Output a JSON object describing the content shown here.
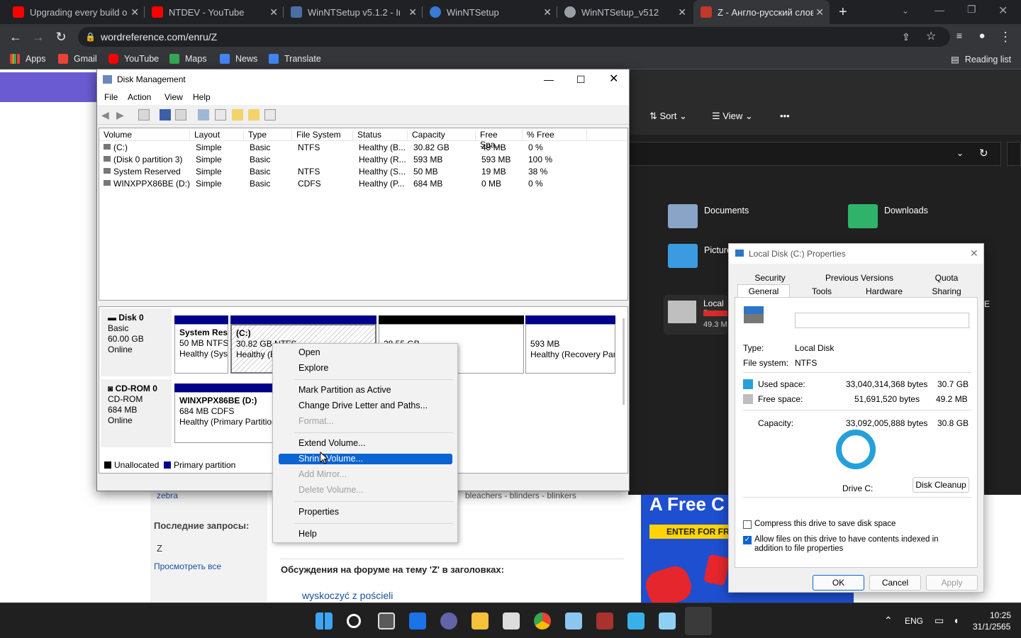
{
  "browser": {
    "tabs": [
      {
        "title": "Upgrading every build o",
        "color": "#ff0000"
      },
      {
        "title": "NTDEV - YouTube",
        "color": "#ff0000"
      },
      {
        "title": "WinNTSetup v5.1.2 - Ims",
        "color": "#4a6fa5"
      },
      {
        "title": "WinNTSetup",
        "color": "#3a7bd5"
      },
      {
        "title": "WinNTSetup_v512",
        "color": "#9aa0a6"
      },
      {
        "title": "Z - Англо-русский слов",
        "color": "#c0392b"
      }
    ],
    "url": "wordreference.com/enru/Z",
    "bookmarks": [
      "Apps",
      "Gmail",
      "YouTube",
      "Maps",
      "News",
      "Translate"
    ],
    "reading_list": "Reading list"
  },
  "webpage": {
    "zebra": "zebra",
    "recent_heading": "Последние запросы:",
    "recent_item": "Z",
    "view_all": "Просмотреть все",
    "forum_heading": "Обсуждения на форуме на тему 'Z' в заголовках:",
    "forum_link": "wyskoczyć z pościeli",
    "words_line": "bleachers - blinders - blinkers",
    "ad_title": "A Free C",
    "ad_button": "ENTER FOR FR"
  },
  "explorer": {
    "sort": "Sort",
    "view": "View",
    "more": "•••",
    "documents": "Documents",
    "downloads": "Downloads",
    "pictures": "Picture",
    "local": "Local D",
    "local_size": "49.3 M",
    "edge_letter": "E"
  },
  "disk_mgmt": {
    "title": "Disk Management",
    "menu": [
      "File",
      "Action",
      "View",
      "Help"
    ],
    "columns": [
      "Volume",
      "Layout",
      "Type",
      "File System",
      "Status",
      "Capacity",
      "Free Spa...",
      "% Free"
    ],
    "rows": [
      [
        "(C:)",
        "Simple",
        "Basic",
        "NTFS",
        "Healthy (B...",
        "30.82 GB",
        "49 MB",
        "0 %"
      ],
      [
        "(Disk 0 partition 3)",
        "Simple",
        "Basic",
        "",
        "Healthy (R...",
        "593 MB",
        "593 MB",
        "100 %"
      ],
      [
        "System Reserved",
        "Simple",
        "Basic",
        "NTFS",
        "Healthy (S...",
        "50 MB",
        "19 MB",
        "38 %"
      ],
      [
        "WINXPPX86BE (D:)",
        "Simple",
        "Basic",
        "CDFS",
        "Healthy (P...",
        "684 MB",
        "0 MB",
        "0 %"
      ]
    ],
    "disk0": {
      "name": "Disk 0",
      "type": "Basic",
      "size": "60.00 GB",
      "status": "Online"
    },
    "disk0_parts": [
      {
        "name": "System Res",
        "size": "50 MB NTFS",
        "status": "Healthy (Sys"
      },
      {
        "name": "(C:)",
        "size": "30.82 GB NTFS",
        "status": "Healthy (B"
      },
      {
        "name": "",
        "size": "28.55 GB",
        "status": ""
      },
      {
        "name": "",
        "size": "593 MB",
        "status": "Healthy (Recovery Par"
      }
    ],
    "cdrom": {
      "name": "CD-ROM 0",
      "type": "CD-ROM",
      "size": "684 MB",
      "status": "Online"
    },
    "cdrom_part": {
      "name": "WINXPPX86BE  (D:)",
      "size": "684 MB CDFS",
      "status": "Healthy (Primary Partition"
    },
    "legend": [
      "Unallocated",
      "Primary partition"
    ]
  },
  "context_menu": {
    "items": [
      {
        "label": "Open",
        "disabled": false
      },
      {
        "label": "Explore",
        "disabled": false
      },
      {
        "label": "Mark Partition as Active",
        "disabled": false
      },
      {
        "label": "Change Drive Letter and Paths...",
        "disabled": false
      },
      {
        "label": "Format...",
        "disabled": true
      },
      {
        "label": "Extend Volume...",
        "disabled": false
      },
      {
        "label": "Shrink Volume...",
        "disabled": false,
        "highlighted": true
      },
      {
        "label": "Add Mirror...",
        "disabled": true
      },
      {
        "label": "Delete Volume...",
        "disabled": true
      },
      {
        "label": "Properties",
        "disabled": false
      },
      {
        "label": "Help",
        "disabled": false
      }
    ]
  },
  "properties": {
    "title": "Local Disk (C:) Properties",
    "tabs_row1": [
      "Security",
      "Previous Versions",
      "Quota"
    ],
    "tabs_row2": [
      "General",
      "Tools",
      "Hardware",
      "Sharing"
    ],
    "type_label": "Type:",
    "type_value": "Local Disk",
    "fs_label": "File system:",
    "fs_value": "NTFS",
    "used_label": "Used space:",
    "used_bytes": "33,040,314,368 bytes",
    "used_gb": "30.7 GB",
    "free_label": "Free space:",
    "free_bytes": "51,691,520 bytes",
    "free_mb": "49.2 MB",
    "cap_label": "Capacity:",
    "cap_bytes": "33,092,005,888 bytes",
    "cap_gb": "30.8 GB",
    "used_fraction": 0.9984,
    "drive_label": "Drive C:",
    "cleanup": "Disk Cleanup",
    "compress": "Compress this drive to save disk space",
    "index": "Allow files on this drive to have contents indexed in addition to file properties",
    "ok": "OK",
    "cancel": "Cancel",
    "apply": "Apply",
    "used_color": "#26a0da",
    "free_color": "#bebebe"
  },
  "taskbar": {
    "lang": "ENG",
    "time": "10:25",
    "date": "31/1/2565"
  }
}
